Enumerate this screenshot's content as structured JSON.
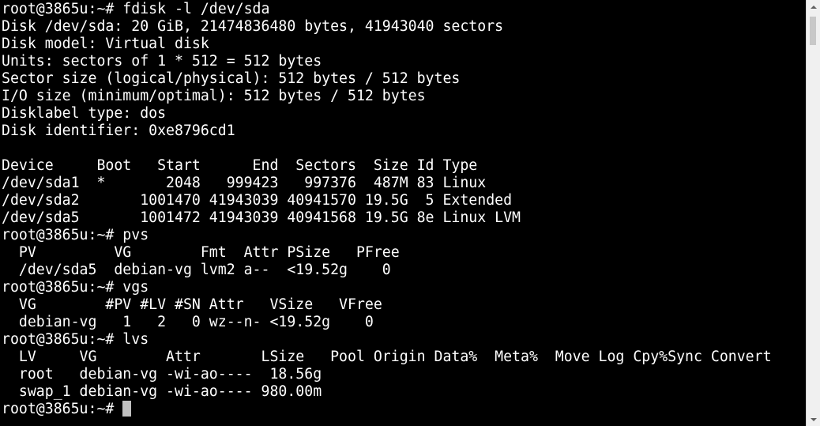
{
  "terminal": {
    "lines": [
      "root@3865u:~# fdisk -l /dev/sda",
      "Disk /dev/sda: 20 GiB, 21474836480 bytes, 41943040 sectors",
      "Disk model: Virtual disk",
      "Units: sectors of 1 * 512 = 512 bytes",
      "Sector size (logical/physical): 512 bytes / 512 bytes",
      "I/O size (minimum/optimal): 512 bytes / 512 bytes",
      "Disklabel type: dos",
      "Disk identifier: 0xe8796cd1",
      "",
      "Device     Boot   Start      End  Sectors  Size Id Type",
      "/dev/sda1  *       2048   999423   997376  487M 83 Linux",
      "/dev/sda2       1001470 41943039 40941570 19.5G  5 Extended",
      "/dev/sda5       1001472 41943039 40941568 19.5G 8e Linux LVM",
      "root@3865u:~# pvs",
      "  PV         VG        Fmt  Attr PSize   PFree",
      "  /dev/sda5  debian-vg lvm2 a--  <19.52g    0",
      "root@3865u:~# vgs",
      "  VG        #PV #LV #SN Attr   VSize   VFree",
      "  debian-vg   1   2   0 wz--n- <19.52g    0",
      "root@3865u:~# lvs",
      "  LV     VG        Attr       LSize   Pool Origin Data%  Meta%  Move Log Cpy%Sync Convert",
      "  root   debian-vg -wi-ao----  18.56g",
      "  swap_1 debian-vg -wi-ao---- 980.00m"
    ],
    "prompt": "root@3865u:~# ",
    "colors": {
      "background": "#000000",
      "foreground": "#ffffff",
      "cursor": "#c0c0c0",
      "scrollbar": "#f0f0f0"
    }
  }
}
